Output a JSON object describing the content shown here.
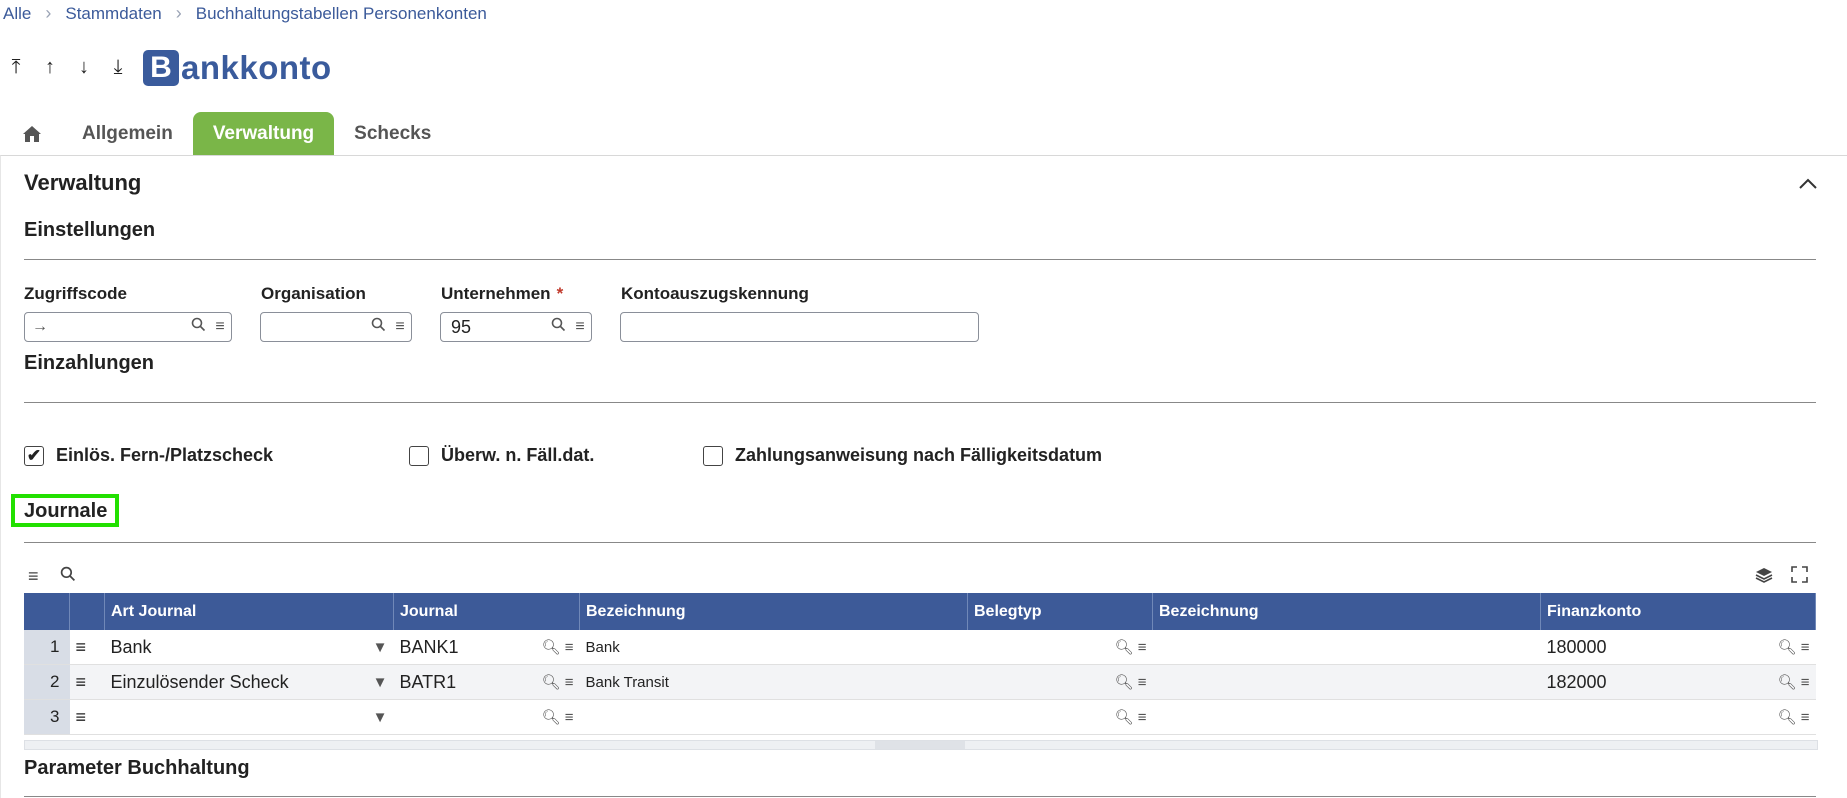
{
  "breadcrumb": [
    "Alle",
    "Stammdaten",
    "Buchhaltungstabellen Personenkonten"
  ],
  "nav": {
    "first": "⤒",
    "up": "↑",
    "down": "↓",
    "last": "⤓"
  },
  "logo": {
    "initial": "B",
    "rest": "ankkonto"
  },
  "tabs": {
    "home_icon": "home-icon",
    "items": [
      "Allgemein",
      "Verwaltung",
      "Schecks"
    ],
    "active": "Verwaltung"
  },
  "section": {
    "title": "Verwaltung"
  },
  "einstellungen": {
    "title": "Einstellungen",
    "zugriffscode": {
      "label": "Zugriffscode",
      "value": ""
    },
    "organisation": {
      "label": "Organisation",
      "value": ""
    },
    "unternehmen": {
      "label": "Unternehmen",
      "required": "*",
      "value": "95"
    },
    "kontoauszug": {
      "label": "Kontoauszugskennung",
      "value": ""
    }
  },
  "einzahlungen": {
    "title": "Einzahlungen",
    "checkboxes": [
      {
        "label": "Einlös. Fern-/Platzscheck",
        "checked": true
      },
      {
        "label": "Überw. n. Fäll.dat.",
        "checked": false
      },
      {
        "label": "Zahlungsanweisung nach Fälligkeitsdatum",
        "checked": false
      }
    ]
  },
  "journale": {
    "title": "Journale",
    "columns": [
      "Art Journal",
      "Journal",
      "Bezeichnung",
      "Belegtyp",
      "Bezeichnung",
      "Finanzkonto"
    ],
    "rows": [
      {
        "num": "1",
        "art": "Bank",
        "journal": "BANK1",
        "bez": "Bank",
        "belegtyp": "",
        "bez2": "",
        "konto": "180000"
      },
      {
        "num": "2",
        "art": "Einzulösender Scheck",
        "journal": "BATR1",
        "bez": "Bank Transit",
        "belegtyp": "",
        "bez2": "",
        "konto": "182000"
      },
      {
        "num": "3",
        "art": "",
        "journal": "",
        "bez": "",
        "belegtyp": "",
        "bez2": "",
        "konto": ""
      }
    ]
  },
  "parameter": {
    "title": "Parameter Buchhaltung"
  },
  "colors": {
    "accent_green": "#7ab648",
    "header_blue": "#3d5a98",
    "highlight": "#22e000"
  }
}
